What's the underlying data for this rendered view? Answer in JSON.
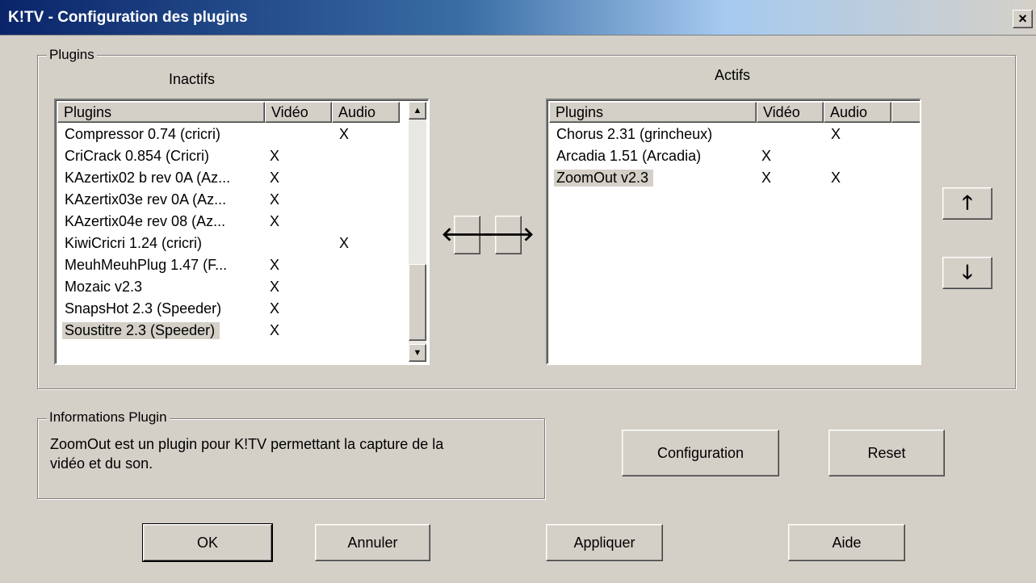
{
  "window": {
    "title": "K!TV - Configuration des plugins",
    "close_label": "×"
  },
  "plugins_group": {
    "legend": "Plugins",
    "inactive_label": "Inactifs",
    "active_label": "Actifs",
    "columns": [
      "Plugins",
      "Vidéo",
      "Audio"
    ],
    "inactive": [
      {
        "name": "Compressor 0.74 (cricri)",
        "video": "",
        "audio": "X"
      },
      {
        "name": "CriCrack 0.854 (Cricri)",
        "video": "X",
        "audio": ""
      },
      {
        "name": "KAzertix02 b rev 0A (Az...",
        "video": "X",
        "audio": ""
      },
      {
        "name": "KAzertix03e rev 0A (Az...",
        "video": "X",
        "audio": ""
      },
      {
        "name": "KAzertix04e rev 08 (Az...",
        "video": "X",
        "audio": ""
      },
      {
        "name": "KiwiCricri 1.24 (cricri)",
        "video": "",
        "audio": "X"
      },
      {
        "name": "MeuhMeuhPlug 1.47 (F...",
        "video": "X",
        "audio": ""
      },
      {
        "name": "Mozaic v2.3",
        "video": "X",
        "audio": ""
      },
      {
        "name": "SnapsHot 2.3 (Speeder)",
        "video": "X",
        "audio": ""
      },
      {
        "name": "Soustitre 2.3 (Speeder)",
        "video": "X",
        "audio": ""
      }
    ],
    "active": [
      {
        "name": "Chorus 2.31 (grincheux)",
        "video": "",
        "audio": "X"
      },
      {
        "name": "Arcadia 1.51 (Arcadia)",
        "video": "X",
        "audio": ""
      },
      {
        "name": "ZoomOut v2.3",
        "video": "X",
        "audio": "X"
      }
    ],
    "move_left_glyph": "🡐",
    "move_right_glyph": "🡒",
    "move_up_glyph": "🡑",
    "move_down_glyph": "🡓",
    "scroll_up_glyph": "▲",
    "scroll_down_glyph": "▼"
  },
  "info_group": {
    "legend": "Informations Plugin",
    "line1": "ZoomOut est un plugin pour K!TV permettant la capture de la",
    "line2": "vidéo et du son."
  },
  "buttons": {
    "configuration": "Configuration",
    "reset": "Reset",
    "ok": "OK",
    "cancel": "Annuler",
    "apply": "Appliquer",
    "help": "Aide"
  },
  "colors": {
    "titlebar_start": "#0a246a",
    "face": "#d4d0c8",
    "selection": "#d4d0c8"
  }
}
